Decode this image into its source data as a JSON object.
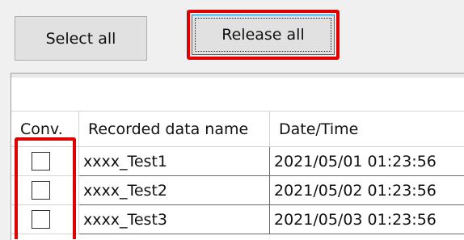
{
  "toolbar": {
    "select_all_label": "Select all",
    "release_all_label": "Release all"
  },
  "grid": {
    "columns": [
      "Conv.",
      "Recorded data name",
      "Date/Time"
    ],
    "rows": [
      {
        "checked": false,
        "name": "xxxx_Test1",
        "datetime": "2021/05/01 01:23:56"
      },
      {
        "checked": false,
        "name": "xxxx_Test2",
        "datetime": "2021/05/02 01:23:56"
      },
      {
        "checked": false,
        "name": "xxxx_Test3",
        "datetime": "2021/05/03 01:23:56"
      }
    ]
  },
  "colors": {
    "highlight": "#e00000",
    "focus_border": "#0078d7"
  }
}
